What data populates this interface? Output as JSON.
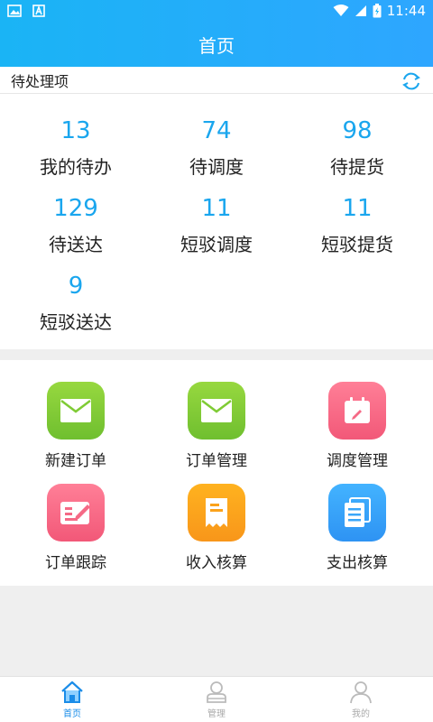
{
  "status_bar": {
    "time": "11:44"
  },
  "header": {
    "title": "首页"
  },
  "pending": {
    "title": "待处理项",
    "items": [
      {
        "count": "13",
        "label": "我的待办"
      },
      {
        "count": "74",
        "label": "待调度"
      },
      {
        "count": "98",
        "label": "待提货"
      },
      {
        "count": "129",
        "label": "待送达"
      },
      {
        "count": "11",
        "label": "短驳调度"
      },
      {
        "count": "11",
        "label": "短驳提货"
      },
      {
        "count": "9",
        "label": "短驳送达"
      }
    ]
  },
  "shortcuts": [
    {
      "label": "新建订单",
      "icon": "envelope-icon",
      "color": "#7fcb35"
    },
    {
      "label": "订单管理",
      "icon": "envelope-icon",
      "color": "#7fcb35"
    },
    {
      "label": "调度管理",
      "icon": "calendar-edit-icon",
      "color": "#f56a86"
    },
    {
      "label": "订单跟踪",
      "icon": "edit-card-icon",
      "color": "#f56a86"
    },
    {
      "label": "收入核算",
      "icon": "receipt-icon",
      "color": "#fba21b"
    },
    {
      "label": "支出核算",
      "icon": "documents-icon",
      "color": "#3aa6f9"
    }
  ],
  "tabbar": {
    "tabs": [
      {
        "label": "首页",
        "icon": "home-icon",
        "active": true
      },
      {
        "label": "管理",
        "icon": "manage-icon",
        "active": false
      },
      {
        "label": "我的",
        "icon": "profile-icon",
        "active": false
      }
    ]
  }
}
